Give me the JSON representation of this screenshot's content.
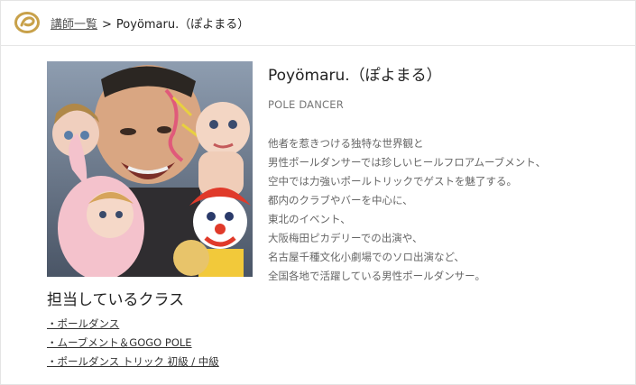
{
  "header": {
    "breadcrumb_parent": "講師一覧",
    "separator": ">",
    "breadcrumb_current": "Poyömaru.（ぽよまる）",
    "brand_color": "#c8a14a"
  },
  "profile": {
    "name": "Poyömaru.（ぽよまる）",
    "role": "POLE DANCER",
    "bio_lines": [
      "他者を惹きつける独特な世界観と",
      "男性ポールダンサーでは珍しいヒールフロアムーブメント、",
      "空中では力強いポールトリックでゲストを魅了する。",
      "都内のクラブやバーを中心に、",
      "東北のイベント、",
      "大阪梅田ピカデリーでの出演や、",
      "名古屋千種文化小劇場でのソロ出演など、",
      "全国各地で活躍している男性ポールダンサー。"
    ]
  },
  "classes": {
    "title": "担当しているクラス",
    "items": [
      "・ポールダンス",
      "・ムーブメント＆GOGO POLE",
      "・ポールダンス トリック 初級 / 中級"
    ]
  }
}
